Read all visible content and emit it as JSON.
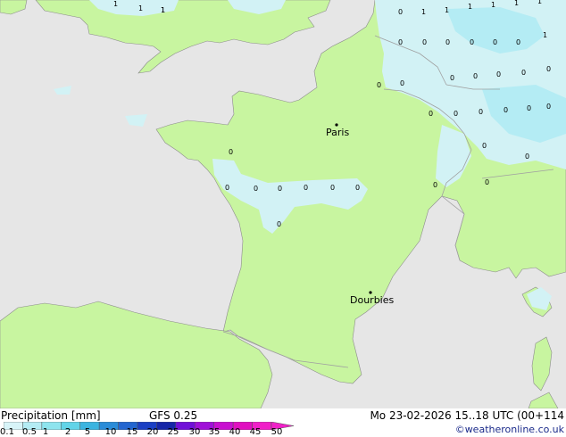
{
  "footer": {
    "title": "Precipitation [mm]",
    "model": "GFS 0.25",
    "valid_time": "Mo 23-02-2026 15..18 UTC (00+114",
    "credit": "©weatheronline.co.uk"
  },
  "legend": {
    "ticks": [
      "0.1",
      "0.5",
      "1",
      "2",
      "5",
      "10",
      "15",
      "20",
      "25",
      "30",
      "35",
      "40",
      "45",
      "50"
    ],
    "colors": [
      "#d8f4f8",
      "#b4ecf4",
      "#8ee4ee",
      "#62d4e8",
      "#3cb4e0",
      "#2a8cd8",
      "#2466d0",
      "#1c40c4",
      "#1626a8",
      "#7010d8",
      "#a010d8",
      "#c810d0",
      "#e010c0",
      "#f020c8"
    ]
  },
  "cities": [
    {
      "name": "Paris"
    },
    {
      "name": "Dourbies"
    }
  ],
  "grid_values": [
    "1",
    "1",
    "1",
    "1",
    "1",
    "1",
    "1",
    "1",
    "1",
    "1",
    "1",
    "0",
    "0",
    "0",
    "0",
    "0",
    "0",
    "0",
    "0",
    "0",
    "0",
    "0",
    "0",
    "0",
    "0",
    "0",
    "0",
    "0",
    "0",
    "0",
    "0",
    "0",
    "0",
    "0",
    "0",
    "0",
    "0",
    "0",
    "0",
    "0",
    "0",
    "0",
    "0"
  ],
  "colors": {
    "land": "#c8f5a0",
    "sea": "#e6e6e6",
    "light_rain": "#d2f2f5",
    "rain": "#b4ecf4",
    "border": "#a0a0a0",
    "coast": "#8c8c8c"
  }
}
